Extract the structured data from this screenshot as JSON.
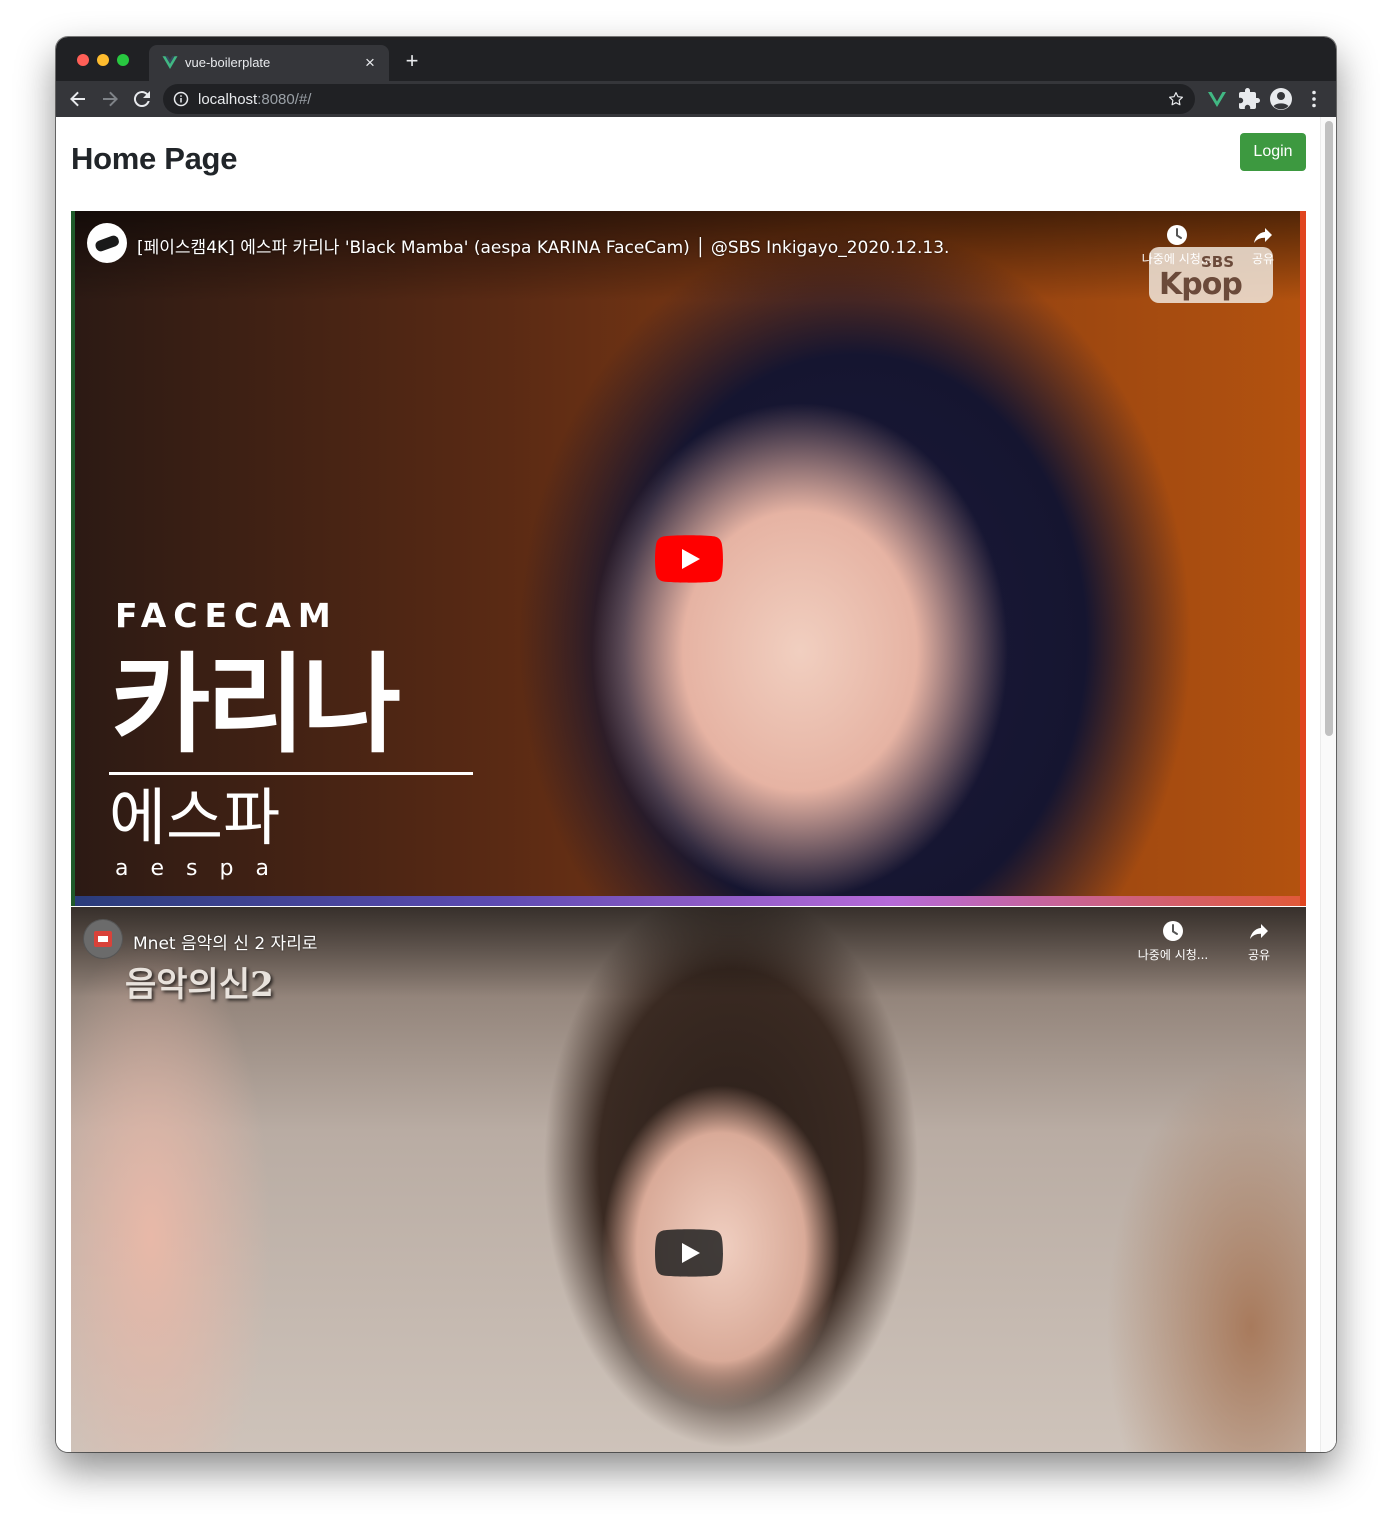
{
  "browser": {
    "tab_title": "vue-boilerplate",
    "new_tab_symbol": "+",
    "close_symbol": "×",
    "url_host": "localhost",
    "url_rest": ":8080/#/"
  },
  "page": {
    "title": "Home Page",
    "login_label": "Login"
  },
  "videos": [
    {
      "title": "[페이스캠4K] 에스파 카리나 'Black Mamba' (aespa KARINA FaceCam) │ @SBS Inkigayo_2020.12.13.",
      "watch_later": "나중에 시청...",
      "share": "공유",
      "overlay": {
        "facecam": "FACECAM",
        "name_kr": "카리나",
        "group_kr": "에스파",
        "group_en": "aespa",
        "logo_top": "SBS",
        "logo_bottom": "Kpop"
      },
      "play_color": "#ff0000"
    },
    {
      "title": "Mnet 음악의 신 2 자리로",
      "watch_later": "나중에 시청...",
      "share": "공유",
      "overlay": {
        "logo": "음악의신2"
      },
      "play_color": "#212121"
    }
  ],
  "icons": {
    "back": "arrow-left-icon",
    "forward": "arrow-right-icon",
    "reload": "reload-icon",
    "info": "info-icon",
    "bookmark": "star-icon",
    "vue_devtools": "vue-icon",
    "extensions": "puzzle-icon",
    "profile": "account-icon",
    "menu": "kebab-menu-icon",
    "watch_later": "clock-icon",
    "share": "share-icon"
  },
  "colors": {
    "login_bg": "#3d9940",
    "browser_dark": "#202124",
    "browser_toolbar": "#35363a",
    "vue_green": "#41b883"
  }
}
